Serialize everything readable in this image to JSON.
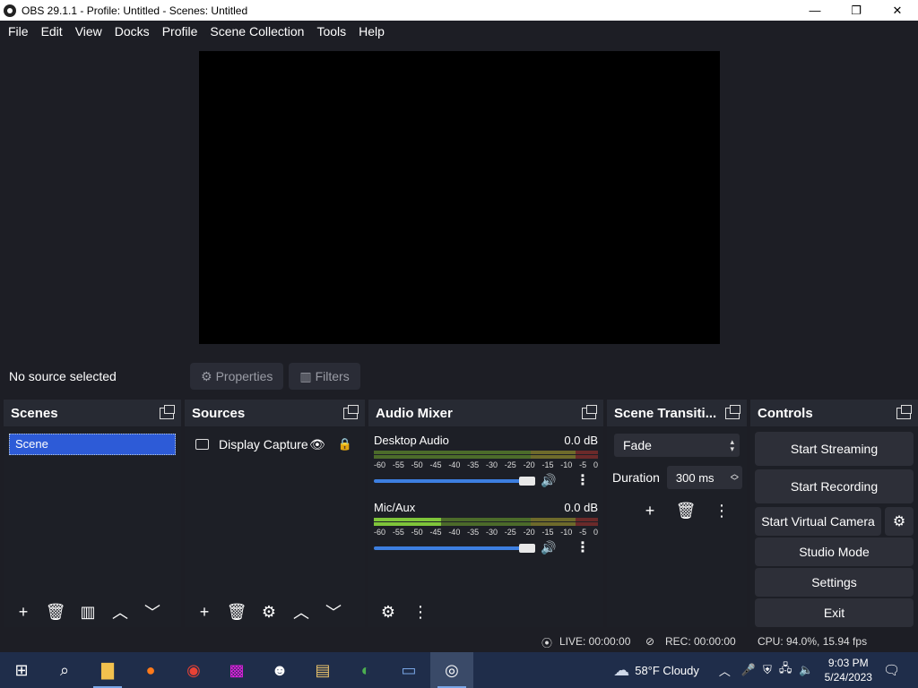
{
  "window": {
    "title": "OBS 29.1.1 - Profile: Untitled - Scenes: Untitled",
    "minimize": "—",
    "maximize": "❐",
    "close": "✕"
  },
  "menu": [
    "File",
    "Edit",
    "View",
    "Docks",
    "Profile",
    "Scene Collection",
    "Tools",
    "Help"
  ],
  "context": {
    "no_source": "No source selected",
    "properties": "Properties",
    "filters": "Filters"
  },
  "scenes": {
    "title": "Scenes",
    "items": [
      "Scene"
    ]
  },
  "sources": {
    "title": "Sources",
    "items": [
      {
        "label": "Display Capture"
      }
    ]
  },
  "mixer": {
    "title": "Audio Mixer",
    "ticks": [
      "-60",
      "-55",
      "-50",
      "-45",
      "-40",
      "-35",
      "-30",
      "-25",
      "-20",
      "-15",
      "-10",
      "-5",
      "0"
    ],
    "channels": [
      {
        "name": "Desktop Audio",
        "db": "0.0 dB",
        "volume": 1.0
      },
      {
        "name": "Mic/Aux",
        "db": "0.0 dB",
        "volume": 1.0
      }
    ]
  },
  "transitions": {
    "title": "Scene Transiti...",
    "selected": "Fade",
    "duration_label": "Duration",
    "duration_value": "300 ms"
  },
  "controls": {
    "title": "Controls",
    "start_streaming": "Start Streaming",
    "start_recording": "Start Recording",
    "start_virtual_camera": "Start Virtual Camera",
    "studio_mode": "Studio Mode",
    "settings": "Settings",
    "exit": "Exit"
  },
  "status": {
    "live": "LIVE: 00:00:00",
    "rec": "REC: 00:00:00",
    "cpu": "CPU: 94.0%, 15.94 fps"
  },
  "taskbar": {
    "weather": "58°F  Cloudy",
    "time": "9:03 PM",
    "date": "5/24/2023"
  }
}
